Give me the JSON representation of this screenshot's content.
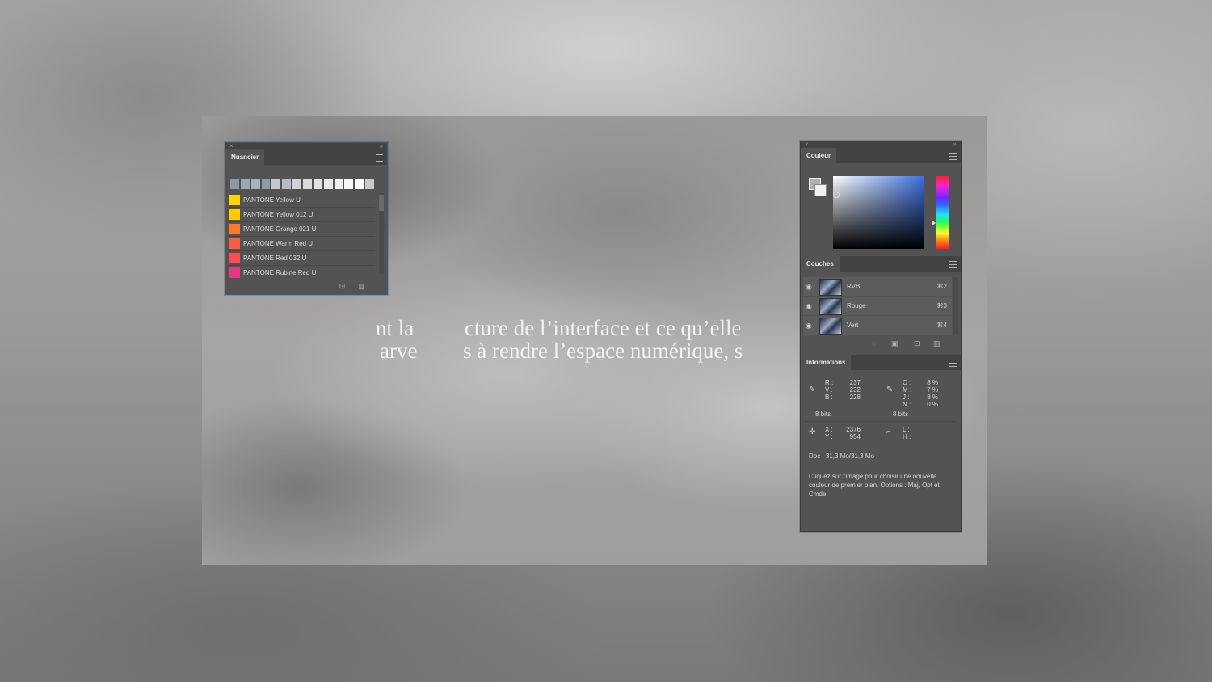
{
  "overlay_text": {
    "line1_left": "nt la",
    "line1_right": "cture de l’interface et ce qu’elle",
    "line2_left": "arve",
    "line2_right": "s à rendre l’espace numérique, s"
  },
  "swatches_panel": {
    "tab_label": "Nuancier",
    "strip_colors": [
      "#8a9aa8",
      "#9aa8b4",
      "#a8b2bc",
      "#8f9ca8",
      "#c4c8cc",
      "#b6bcc2",
      "#cfd2d4",
      "#d9dbdc",
      "#e2e3e4",
      "#e9e9ea",
      "#f0f0f0",
      "#f6f6f6",
      "#fafafa",
      "#c9c9c9"
    ],
    "items": [
      {
        "name": "PANTONE Yellow U",
        "color": "#ffd400"
      },
      {
        "name": "PANTONE Yellow 012 U",
        "color": "#ffcc00"
      },
      {
        "name": "PANTONE Orange 021 U",
        "color": "#ff7a2a"
      },
      {
        "name": "PANTONE Warm Red U",
        "color": "#ff5a4a"
      },
      {
        "name": "PANTONE Red 032 U",
        "color": "#ff4a52"
      },
      {
        "name": "PANTONE Rubine Red U",
        "color": "#e23a7a"
      }
    ]
  },
  "color_panel": {
    "tab_label": "Couleur",
    "picker_color": "#3a6fe0"
  },
  "layers_panel": {
    "tab_label": "Couches",
    "rows": [
      {
        "name": "RVB",
        "shortcut": "⌘2"
      },
      {
        "name": "Rouge",
        "shortcut": "⌘3"
      },
      {
        "name": "Vert",
        "shortcut": "⌘4"
      }
    ]
  },
  "info_panel": {
    "tab_label": "Informations",
    "rgb": {
      "r_label": "R :",
      "r": "237",
      "v_label": "V :",
      "v": "232",
      "b_label": "B :",
      "b": "228",
      "bits": "8 bits"
    },
    "cmyk": {
      "c_label": "C :",
      "c": "8 %",
      "m_label": "M :",
      "m": "7 %",
      "j_label": "J :",
      "j": "8 %",
      "n_label": "N :",
      "n": "0 %",
      "bits": "8 bits"
    },
    "xy": {
      "x_label": "X :",
      "x": "2376",
      "y_label": "Y :",
      "y": "954"
    },
    "lh": {
      "l_label": "L :",
      "h_label": "H :"
    },
    "doc": "Doc : 31,3 Mo/31,3 Mo",
    "help": "Cliquez sur l'image pour choisir une nouvelle couleur de premier plan. Options : Maj, Opt et Cmde."
  }
}
